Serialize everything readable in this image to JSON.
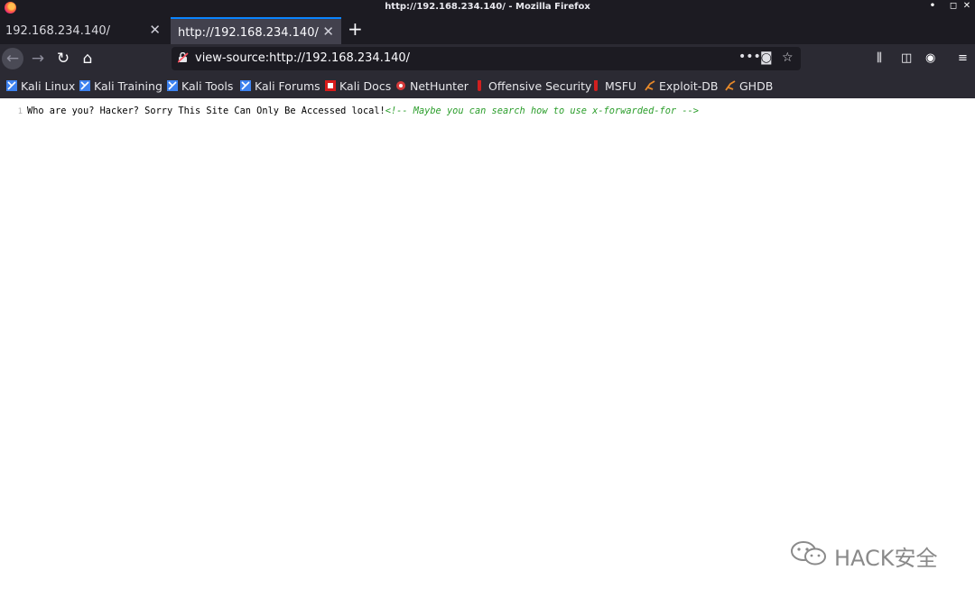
{
  "window": {
    "title": "http://192.168.234.140/ - Mozilla Firefox",
    "controls": {
      "minimize": "•",
      "maximize": "◻",
      "close": "✕"
    }
  },
  "tabs": [
    {
      "label": "192.168.234.140/",
      "active": false
    },
    {
      "label": "http://192.168.234.140/",
      "active": true
    }
  ],
  "new_tab_label": "+",
  "navbar": {
    "url": "view-source:http://192.168.234.140/",
    "icons": [
      "back-icon",
      "forward-icon",
      "reload-icon",
      "home-icon",
      "page-actions-icon",
      "pocket-icon",
      "bookmark-star-icon",
      "library-icon",
      "sidebar-icon",
      "account-icon",
      "menu-icon"
    ]
  },
  "bookmarks": [
    {
      "label": "Kali Linux",
      "icon": "kali-icon"
    },
    {
      "label": "Kali Training",
      "icon": "kali-icon"
    },
    {
      "label": "Kali Tools",
      "icon": "kali-icon"
    },
    {
      "label": "Kali Forums",
      "icon": "kali-icon"
    },
    {
      "label": "Kali Docs",
      "icon": "kali-docs-icon"
    },
    {
      "label": "NetHunter",
      "icon": "nethunter-icon"
    },
    {
      "label": "Offensive Security",
      "icon": "offsec-icon"
    },
    {
      "label": "MSFU",
      "icon": "offsec-icon"
    },
    {
      "label": "Exploit-DB",
      "icon": "exploitdb-icon"
    },
    {
      "label": "GHDB",
      "icon": "exploitdb-icon"
    }
  ],
  "source": {
    "line_number": "1",
    "text": "Who are you? Hacker? Sorry This Site Can Only Be Accessed local!",
    "comment": "<!-- Maybe you can search how to use x-forwarded-for -->"
  },
  "watermark": {
    "text": "HACK安全"
  },
  "colors": {
    "titlebar_bg": "#1c1b22",
    "toolbar_bg": "#2b2a33",
    "active_tab_accent": "#0a84ff",
    "comment_green": "#2a9d2a"
  }
}
